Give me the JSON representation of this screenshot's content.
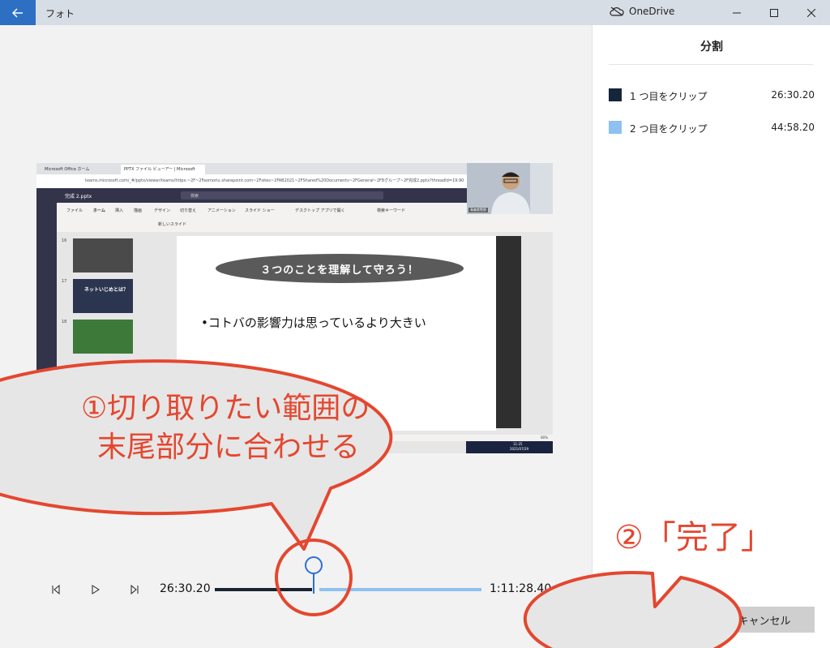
{
  "app": {
    "title": "フォト",
    "onedrive_label": "OneDrive"
  },
  "panel": {
    "title": "分割",
    "clips": [
      {
        "label": "1 つ目をクリップ",
        "time": "26:30.20",
        "color": "#15263a"
      },
      {
        "label": "2 つ目をクリップ",
        "time": "44:58.20",
        "color": "#8ec1ef"
      }
    ],
    "done_label": "完了",
    "cancel_label": "キャンセル"
  },
  "preview": {
    "tabs": [
      "Microsoft Office ホーム",
      "PPTX ファイル ビューアー | Microsoft"
    ],
    "address": "teams.microsoft.com/_#/pptx/viewer/teams/https:~2F~2Faomoriu.sharepoint.com~2Fsites~2FAB2021~2FShared%20Documents~2FGeneral~2F8グループ~2F完成2.pptx?threadId=19:90",
    "file_name": "完成 2.pptx",
    "search_placeholder": "検索",
    "ribbon_tabs": [
      "ファイル",
      "ホーム",
      "挿入",
      "描画",
      "デザイン",
      "切り替え",
      "アニメーション",
      "スライド ショー",
      "デスクトップ アプリで開く",
      "検索キーワード"
    ],
    "new_slide_label": "新しいスライド",
    "slide_numbers": [
      "16",
      "17",
      "18"
    ],
    "thumb_title": "ネットいじめとは？",
    "slide_pill_text": "３つのことを理解して守ろう！",
    "slide_bullet": "•コトバの影響力は思っているより大きい",
    "webcam_name": "青森県警察",
    "taskbar_time": "11:25",
    "taskbar_date": "2021/07/29",
    "zoom": "80%"
  },
  "timeline": {
    "start_time": "26:30.20",
    "end_time": "1:11:28.40",
    "split_fraction": 0.37
  },
  "callouts": {
    "callout1_line1": "①切り取りたい範囲の",
    "callout1_line2": "末尾部分に合わせる",
    "callout2": "②「完了」"
  },
  "colors": {
    "accent": "#2e82e0",
    "callout_red": "#e4472f",
    "callout_fill": "#e6e6e6",
    "marker_blue": "#2e6ed6"
  },
  "icons": [
    "back-arrow-icon",
    "cloud-sync-icon",
    "minimize-icon",
    "maximize-icon",
    "close-icon",
    "previous-frame-icon",
    "play-icon",
    "next-frame-icon"
  ]
}
